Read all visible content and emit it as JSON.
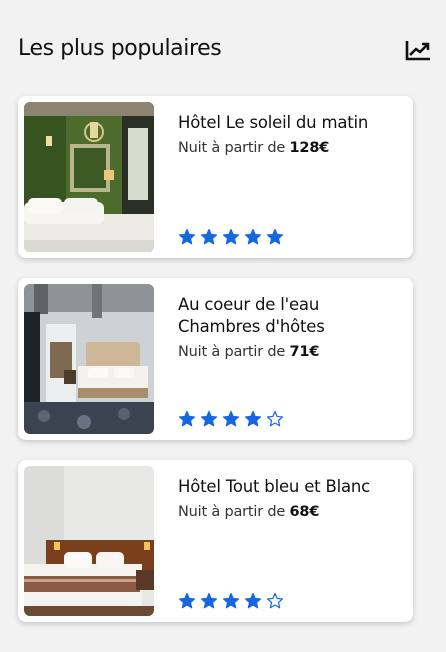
{
  "header": {
    "title": "Les plus populaires",
    "icon": "trending-up-icon"
  },
  "colors": {
    "accent": "#1667e0",
    "background": "#f2f2f2",
    "card": "#ffffff"
  },
  "hotels": [
    {
      "name": "Hôtel Le soleil du matin",
      "price_prefix": "Nuit à partir de",
      "price": "128€",
      "rating": 5,
      "max_rating": 5
    },
    {
      "name": "Au coeur de l'eau Chambres d'hôtes",
      "price_prefix": "Nuit à partir de",
      "price": "71€",
      "rating": 4,
      "max_rating": 5
    },
    {
      "name": "Hôtel Tout bleu et Blanc",
      "price_prefix": "Nuit à partir de",
      "price": "68€",
      "rating": 4,
      "max_rating": 5
    }
  ]
}
